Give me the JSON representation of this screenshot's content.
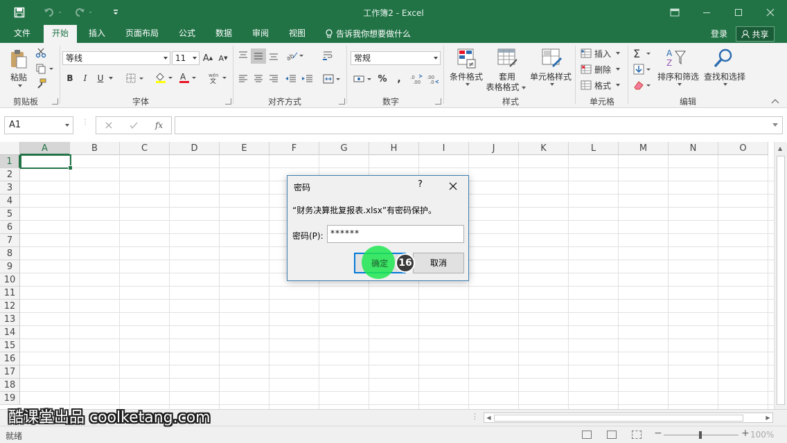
{
  "window": {
    "title": "工作簿2 - Excel"
  },
  "ribbon_tabs": [
    {
      "label": "文件"
    },
    {
      "label": "开始"
    },
    {
      "label": "插入"
    },
    {
      "label": "页面布局"
    },
    {
      "label": "公式"
    },
    {
      "label": "数据"
    },
    {
      "label": "审阅"
    },
    {
      "label": "视图"
    }
  ],
  "tellme": "告诉我你想要做什么",
  "account": {
    "login": "登录",
    "share": "共享"
  },
  "groups": {
    "clipboard": {
      "label": "剪贴板",
      "paste": "粘贴"
    },
    "font": {
      "label": "字体",
      "font_name": "等线",
      "font_size": "11",
      "bold": "B",
      "italic": "I",
      "underline": "U"
    },
    "alignment": {
      "label": "对齐方式"
    },
    "number": {
      "label": "数字",
      "format": "常规",
      "percent": "%"
    },
    "styles": {
      "label": "样式",
      "conditional": "条件格式",
      "table_line1": "套用",
      "table_line2": "表格格式",
      "cell_styles": "单元格样式"
    },
    "cells": {
      "label": "单元格",
      "insert": "插入",
      "delete": "删除",
      "format": "格式"
    },
    "editing": {
      "label": "编辑",
      "sort": "排序和筛选",
      "find": "查找和选择"
    }
  },
  "formula_bar": {
    "name_box": "A1",
    "fx": "fx"
  },
  "columns": [
    "A",
    "B",
    "C",
    "D",
    "E",
    "F",
    "G",
    "H",
    "I",
    "J",
    "K",
    "L",
    "M",
    "N",
    "O"
  ],
  "rows": [
    "1",
    "2",
    "3",
    "4",
    "5",
    "6",
    "7",
    "8",
    "9",
    "10",
    "11",
    "12",
    "13",
    "14",
    "15",
    "16",
    "17",
    "18",
    "19"
  ],
  "status": {
    "ready": "就绪",
    "zoom": "100%"
  },
  "watermark": "酷课堂出品 coolketang.com",
  "dialog": {
    "title": "密码",
    "help": "?",
    "message": "“财务决算批复报表.xlsx”有密码保护。",
    "password_label": "密码(P):",
    "password_value": "******",
    "ok": "确定",
    "cancel": "取消"
  },
  "step_badge": "16",
  "colors": {
    "brand": "#217346",
    "dialog_border": "#3c7fb1",
    "click_highlight": "#1ee650"
  }
}
